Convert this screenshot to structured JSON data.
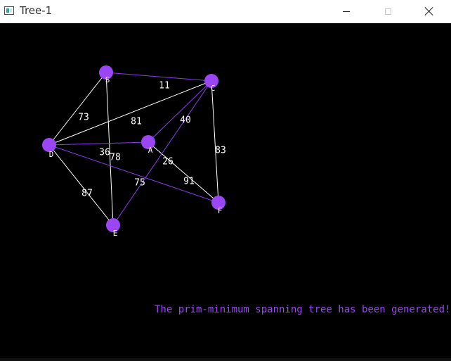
{
  "window": {
    "title": "Tree-1",
    "controls": [
      "minimize-icon",
      "maximize-icon",
      "close-icon"
    ]
  },
  "colors": {
    "background": "#000000",
    "node": "#9b46f5",
    "tree_edge": "#8a3cf0",
    "graph_edge": "#ffffff",
    "status_text": "#9b46f5"
  },
  "graph": {
    "nodes": [
      {
        "id": "S",
        "label": "S"
      },
      {
        "id": "C",
        "label": "C"
      },
      {
        "id": "D",
        "label": "D"
      },
      {
        "id": "A",
        "label": "A"
      },
      {
        "id": "F",
        "label": "F"
      },
      {
        "id": "E",
        "label": "E"
      }
    ],
    "edges": [
      {
        "from": "S",
        "to": "C",
        "weight": "11",
        "in_tree": true
      },
      {
        "from": "S",
        "to": "D",
        "weight": "73",
        "in_tree": false
      },
      {
        "from": "S",
        "to": "E",
        "weight": "78",
        "in_tree": false
      },
      {
        "from": "D",
        "to": "C",
        "weight": "81",
        "in_tree": false
      },
      {
        "from": "A",
        "to": "C",
        "weight": "40",
        "in_tree": true
      },
      {
        "from": "C",
        "to": "F",
        "weight": "83",
        "in_tree": false
      },
      {
        "from": "D",
        "to": "A",
        "weight": "36",
        "in_tree": true
      },
      {
        "from": "A",
        "to": "F",
        "weight": "26",
        "in_tree": false
      },
      {
        "from": "D",
        "to": "F",
        "weight": "75",
        "in_tree": true
      },
      {
        "from": "C",
        "to": "E",
        "weight": "91",
        "in_tree": true
      },
      {
        "from": "D",
        "to": "E",
        "weight": "87",
        "in_tree": false
      }
    ]
  },
  "status": {
    "message": "The prim-minimum spanning tree has been generated!"
  }
}
